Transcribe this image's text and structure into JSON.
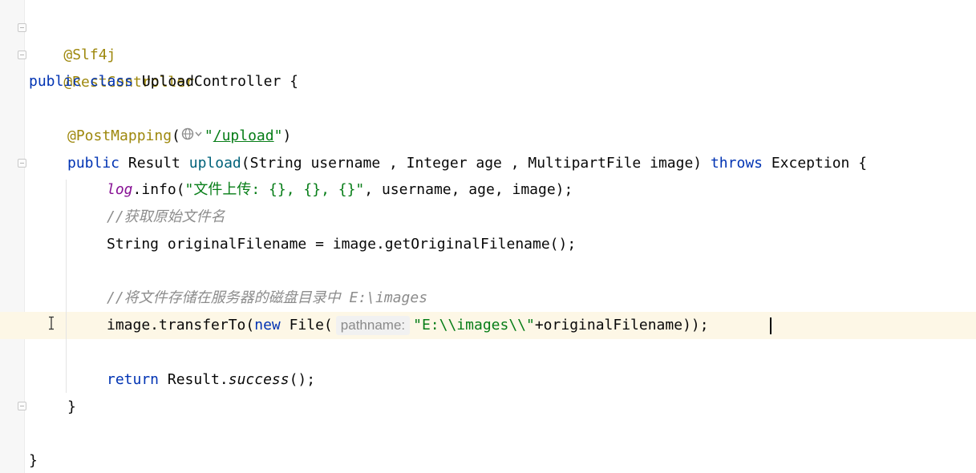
{
  "code": {
    "line1": {
      "annotation": "@Slf4j"
    },
    "line2": {
      "annotation": "@RestController"
    },
    "line3": {
      "kw_public": "public",
      "kw_class": "class",
      "rest": " UploadController {"
    },
    "line5": {
      "annotation": "@PostMapping",
      "open_paren": "(",
      "quote_open": "\"",
      "path": "/upload",
      "quote_close": "\"",
      "close_paren": ")"
    },
    "line6": {
      "kw_public": "public",
      "ret_type": " Result ",
      "method": "upload",
      "params_a": "(String username , Integer age , MultipartFile image) ",
      "kw_throws": "throws",
      "params_b": " Exception {"
    },
    "line7": {
      "field": "log",
      "call": ".info(",
      "string": "\"文件上传: {}, {}, {}\"",
      "args": ", username, age, image);"
    },
    "line8": {
      "comment": "//获取原始文件名"
    },
    "line9": {
      "text": "String originalFilename = image.getOriginalFilename();"
    },
    "line11": {
      "comment": "//将文件存储在服务器的磁盘目录中 E:\\images"
    },
    "line12": {
      "call": "image.transferTo(",
      "kw_new": "new",
      "ctor": " File(",
      "param_hint": "pathname:",
      "string": "\"E:\\\\images\\\\\"",
      "rest": "+originalFilename));"
    },
    "line14": {
      "kw_return": "return",
      "rest_a": " Result.",
      "static_call": "success",
      "rest_b": "();"
    },
    "line15": {
      "brace": "}"
    },
    "line17": {
      "brace": "}"
    }
  },
  "icons": {
    "globe": "globe-icon",
    "fold": "fold-marker-icon",
    "cursor": "text-cursor-icon"
  },
  "colors": {
    "annotation": "#9e880d",
    "keyword": "#0033b3",
    "string": "#067d17",
    "field": "#871094",
    "method": "#00627a",
    "comment": "#8c8c8c",
    "current_line": "#fdf7e6"
  }
}
